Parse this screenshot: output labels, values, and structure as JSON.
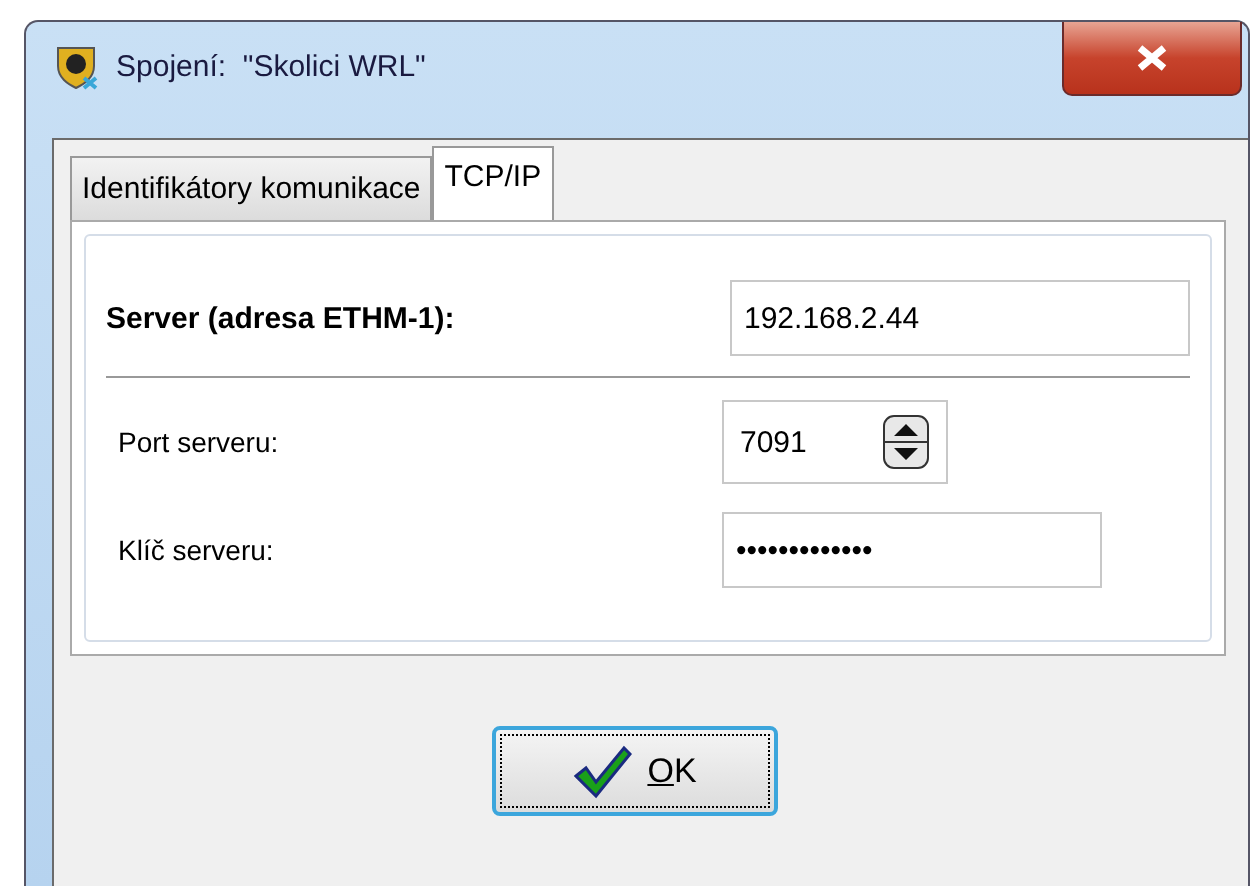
{
  "window": {
    "title": "Spojení:  \"Skolici WRL\""
  },
  "tabs": [
    {
      "label": "Identifikátory komunikace",
      "selected": false
    },
    {
      "label": "TCP/IP",
      "selected": true
    }
  ],
  "server": {
    "label": "Server (adresa ETHM-1):",
    "value": "192.168.2.44"
  },
  "port": {
    "label": "Port serveru:",
    "value": "7091"
  },
  "key": {
    "label": "Klíč serveru:",
    "value": "•••••••••••••"
  },
  "buttons": [
    {
      "label": "OK",
      "kind": "ok"
    }
  ]
}
